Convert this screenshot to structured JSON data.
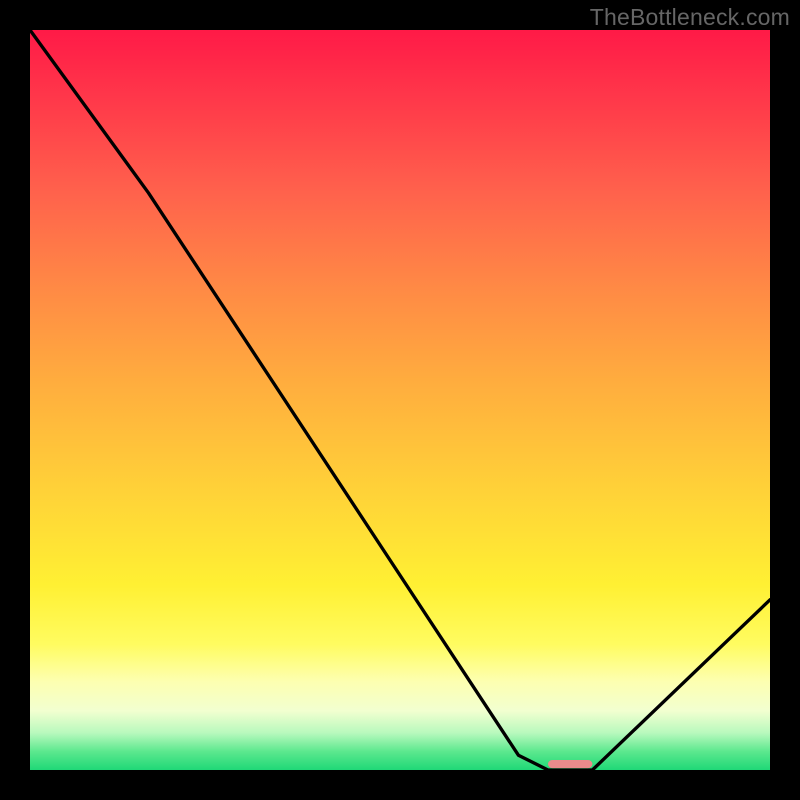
{
  "watermark": "TheBottleneck.com",
  "chart_data": {
    "type": "line",
    "title": "",
    "xlabel": "",
    "ylabel": "",
    "xlim": [
      0,
      100
    ],
    "ylim": [
      0,
      100
    ],
    "grid": false,
    "series": [
      {
        "name": "curve",
        "color": "#000000",
        "x": [
          0,
          16,
          66,
          70,
          76,
          100
        ],
        "values": [
          100,
          78,
          2,
          0,
          0,
          23
        ]
      }
    ],
    "marker": {
      "name": "optimal-range",
      "color": "#e98b8b",
      "x_start": 70,
      "x_end": 76,
      "y": 0.8,
      "thickness_pct": 1.1
    }
  }
}
